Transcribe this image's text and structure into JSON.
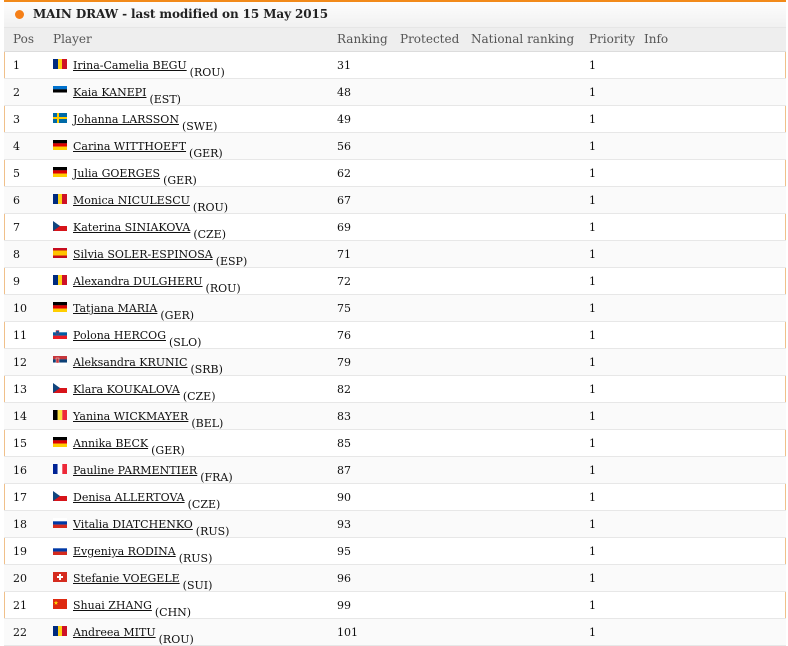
{
  "title": "MAIN DRAW - last modified on 15 May 2015",
  "columns": {
    "pos": "Pos",
    "player": "Player",
    "ranking": "Ranking",
    "protected": "Protected",
    "national_ranking": "National ranking",
    "priority": "Priority",
    "info": "Info"
  },
  "rows": [
    {
      "pos": "1",
      "name": "Irina-Camelia BEGU",
      "country": "(ROU)",
      "ranking": "31",
      "priority": "1",
      "flag": "ROU"
    },
    {
      "pos": "2",
      "name": "Kaia KANEPI",
      "country": "(EST)",
      "ranking": "48",
      "priority": "1",
      "flag": "EST"
    },
    {
      "pos": "3",
      "name": "Johanna LARSSON",
      "country": "(SWE)",
      "ranking": "49",
      "priority": "1",
      "flag": "SWE"
    },
    {
      "pos": "4",
      "name": "Carina WITTHOEFT",
      "country": "(GER)",
      "ranking": "56",
      "priority": "1",
      "flag": "GER"
    },
    {
      "pos": "5",
      "name": "Julia GOERGES",
      "country": "(GER)",
      "ranking": "62",
      "priority": "1",
      "flag": "GER"
    },
    {
      "pos": "6",
      "name": "Monica NICULESCU",
      "country": "(ROU)",
      "ranking": "67",
      "priority": "1",
      "flag": "ROU"
    },
    {
      "pos": "7",
      "name": "Katerina SINIAKOVA",
      "country": "(CZE)",
      "ranking": "69",
      "priority": "1",
      "flag": "CZE"
    },
    {
      "pos": "8",
      "name": "Silvia SOLER-ESPINOSA",
      "country": "(ESP)",
      "ranking": "71",
      "priority": "1",
      "flag": "ESP"
    },
    {
      "pos": "9",
      "name": "Alexandra DULGHERU",
      "country": "(ROU)",
      "ranking": "72",
      "priority": "1",
      "flag": "ROU"
    },
    {
      "pos": "10",
      "name": "Tatjana MARIA",
      "country": "(GER)",
      "ranking": "75",
      "priority": "1",
      "flag": "GER"
    },
    {
      "pos": "11",
      "name": "Polona HERCOG",
      "country": "(SLO)",
      "ranking": "76",
      "priority": "1",
      "flag": "SLO"
    },
    {
      "pos": "12",
      "name": "Aleksandra KRUNIC",
      "country": "(SRB)",
      "ranking": "79",
      "priority": "1",
      "flag": "SRB"
    },
    {
      "pos": "13",
      "name": "Klara KOUKALOVA",
      "country": "(CZE)",
      "ranking": "82",
      "priority": "1",
      "flag": "CZE"
    },
    {
      "pos": "14",
      "name": "Yanina WICKMAYER",
      "country": "(BEL)",
      "ranking": "83",
      "priority": "1",
      "flag": "BEL"
    },
    {
      "pos": "15",
      "name": "Annika BECK",
      "country": "(GER)",
      "ranking": "85",
      "priority": "1",
      "flag": "GER"
    },
    {
      "pos": "16",
      "name": "Pauline PARMENTIER",
      "country": "(FRA)",
      "ranking": "87",
      "priority": "1",
      "flag": "FRA"
    },
    {
      "pos": "17",
      "name": "Denisa ALLERTOVA",
      "country": "(CZE)",
      "ranking": "90",
      "priority": "1",
      "flag": "CZE"
    },
    {
      "pos": "18",
      "name": "Vitalia DIATCHENKO",
      "country": "(RUS)",
      "ranking": "93",
      "priority": "1",
      "flag": "RUS"
    },
    {
      "pos": "19",
      "name": "Evgeniya RODINA",
      "country": "(RUS)",
      "ranking": "95",
      "priority": "1",
      "flag": "RUS"
    },
    {
      "pos": "20",
      "name": "Stefanie VOEGELE",
      "country": "(SUI)",
      "ranking": "96",
      "priority": "1",
      "flag": "SUI"
    },
    {
      "pos": "21",
      "name": "Shuai ZHANG",
      "country": "(CHN)",
      "ranking": "99",
      "priority": "1",
      "flag": "CHN"
    },
    {
      "pos": "22",
      "name": "Andreea MITU",
      "country": "(ROU)",
      "ranking": "101",
      "priority": "1",
      "flag": "ROU"
    }
  ]
}
